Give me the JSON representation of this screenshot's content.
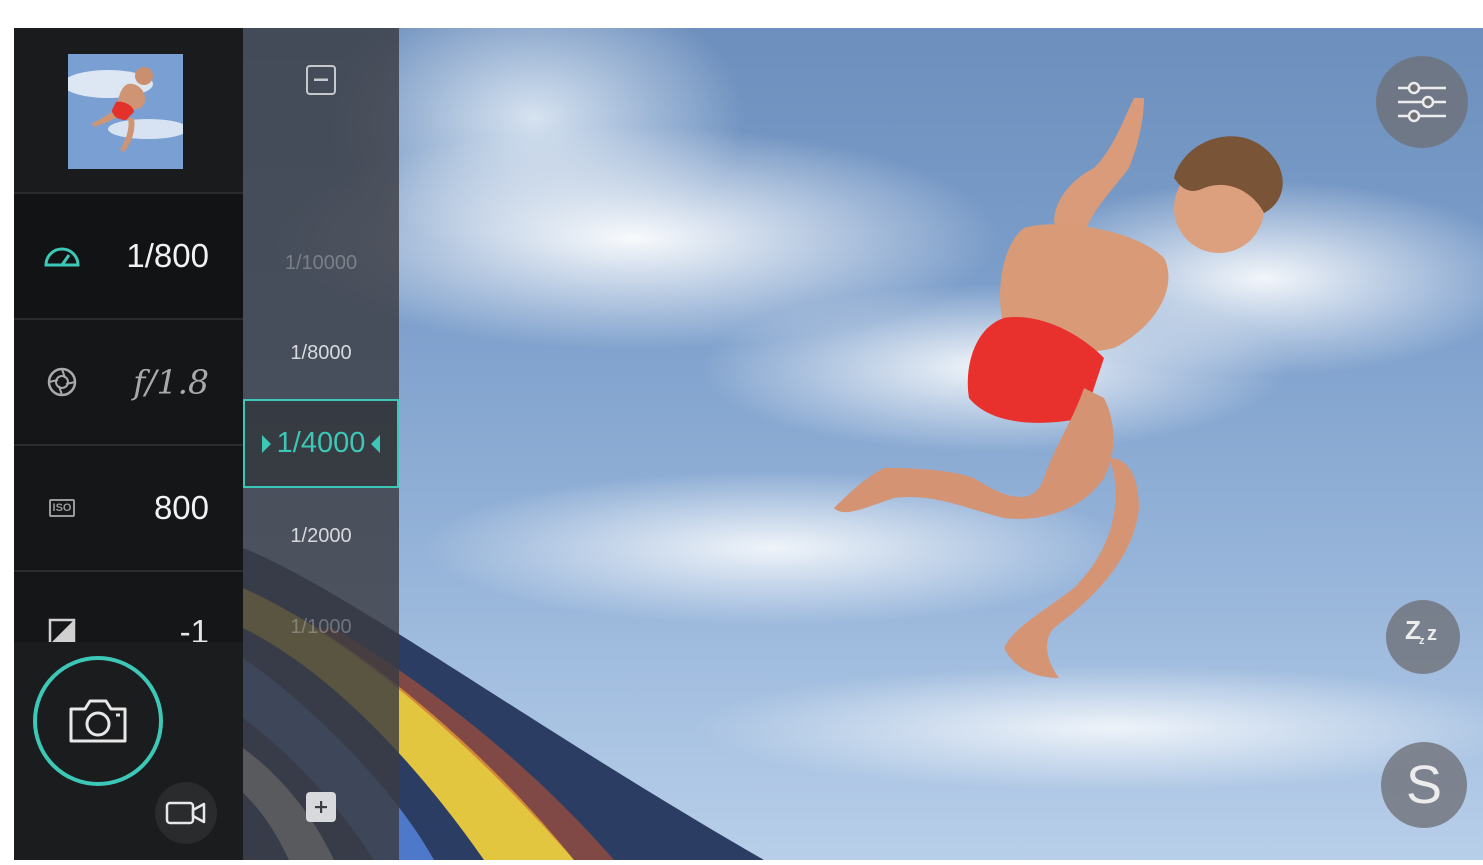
{
  "exposure": {
    "shutter_speed": "1/800",
    "aperture": "f/1.8",
    "iso_icon_label": "ISO",
    "iso": "800",
    "ev": "-1"
  },
  "shutter_picker": {
    "options": [
      "1/10000",
      "1/8000",
      "1/4000",
      "1/2000",
      "1/1000"
    ],
    "selected": "1/4000"
  },
  "icons": {
    "shutter_speed": "speedometer-icon",
    "aperture": "aperture-icon",
    "iso": "iso-icon",
    "ev": "exposure-compensation-icon",
    "picker_minus": "minus-icon",
    "picker_plus": "plus-icon",
    "capture": "camera-icon",
    "video": "video-camera-icon",
    "settings": "sliders-icon",
    "sleep": "sleep-zzz-icon",
    "s_mode": "s-mode-icon"
  },
  "fab": {
    "sleep_label": "Zzz",
    "s_label": "S"
  },
  "colors": {
    "accent": "#3cc7b6",
    "panel_bg": "#151618"
  }
}
